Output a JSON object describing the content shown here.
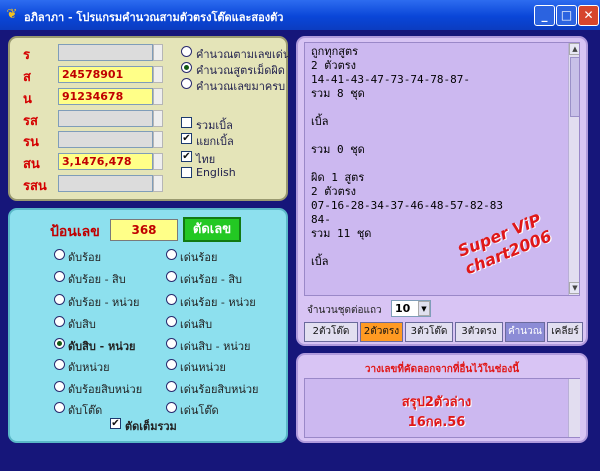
{
  "window": {
    "title": "อภิลาภา - โปรแกรมคำนวณสามตัวตรงโต๊ดและสองตัว",
    "app_icon": "wings-icon"
  },
  "inputs": {
    "fields": [
      {
        "label": "ร",
        "value": ""
      },
      {
        "label": "ส",
        "value": "24578901"
      },
      {
        "label": "น",
        "value": "91234678"
      },
      {
        "label": "รส",
        "value": ""
      },
      {
        "label": "รน",
        "value": ""
      },
      {
        "label": "สน",
        "value": "3,1476,478"
      },
      {
        "label": "รสน",
        "value": ""
      }
    ],
    "mode_options": [
      {
        "label": "คำนวณตามเลขเด่น",
        "selected": false
      },
      {
        "label": "คำนวณสูตรเม็ดผิด",
        "selected": true
      },
      {
        "label": "คำนวณเลขมาครบ",
        "selected": false
      }
    ],
    "checks": [
      {
        "label": "รวมเบิ้ล",
        "checked": false
      },
      {
        "label": "แยกเบิ้ล",
        "checked": true
      },
      {
        "label": "ไทย",
        "checked": true
      },
      {
        "label": "English",
        "checked": false
      }
    ]
  },
  "digits": {
    "input_label": "ป้อนเลข",
    "input_value": "368",
    "cut_button": "ตัดเลข",
    "left_options": [
      {
        "label": "ดับร้อย",
        "selected": false
      },
      {
        "label": "ดับร้อย - สิบ",
        "selected": false
      },
      {
        "label": "ดับร้อย - หน่วย",
        "selected": false
      },
      {
        "label": "ดับสิบ",
        "selected": false
      },
      {
        "label": "ดับสิบ - หน่วย",
        "selected": true
      },
      {
        "label": "ดับหน่วย",
        "selected": false
      },
      {
        "label": "ดับร้อยสิบหน่วย",
        "selected": false
      },
      {
        "label": "ดับโต๊ด",
        "selected": false
      }
    ],
    "right_options": [
      {
        "label": "เด่นร้อย",
        "selected": false
      },
      {
        "label": "เด่นร้อย - สิบ",
        "selected": false
      },
      {
        "label": "เด่นร้อย - หน่วย",
        "selected": false
      },
      {
        "label": "เด่นสิบ",
        "selected": false
      },
      {
        "label": "เด่นสิบ - หน่วย",
        "selected": false
      },
      {
        "label": "เด่นหน่วย",
        "selected": false
      },
      {
        "label": "เด่นร้อยสิบหน่วย",
        "selected": false
      },
      {
        "label": "เด่นโต๊ด",
        "selected": false
      }
    ],
    "total_check_label": "ตัดเต็มรวม",
    "total_checked": true
  },
  "result": {
    "lines": "ถูกทุกสูตร\n2 ตัวตรง\n14-41-43-47-73-74-78-87-\nรวม 8 ชุด\n\nเบิ้ล\n\nรวม 0 ชุด\n\nผิด 1 สูตร\n2 ตัวตรง\n07-16-28-34-37-46-48-57-82-83\n84-\nรวม 11 ชุด\n\nเบิ้ล",
    "watermark_line1": "Super ViP",
    "watermark_line2": "chart2006",
    "per_row_label": "จำนวนชุดต่อแถว",
    "per_row_value": "10",
    "tabs": [
      {
        "label": "2ตัวโต๊ด"
      },
      {
        "label": "2ตัวตรง"
      },
      {
        "label": "3ตัวโต๊ด"
      },
      {
        "label": "3ตัวตรง"
      },
      {
        "label": "คำนวณ"
      },
      {
        "label": "เคลียร์"
      }
    ]
  },
  "note": {
    "title": "วางเลขที่คัดลอกจากที่อื่นไว้ในช่องนี้",
    "line1": "สรุป2ตัวล่าง",
    "line2": "16กค.56"
  }
}
